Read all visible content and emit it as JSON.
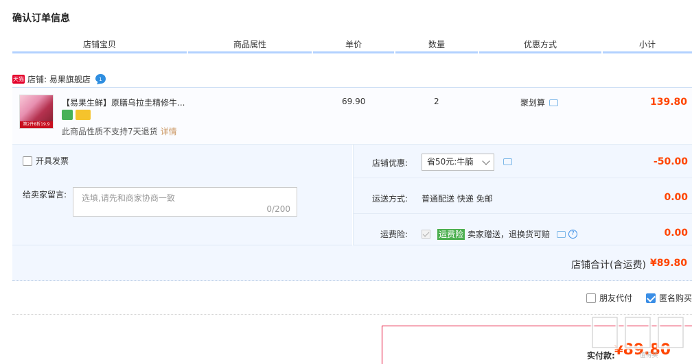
{
  "page_title": "确认订单信息",
  "columns": [
    "店铺宝贝",
    "商品属性",
    "单价",
    "数量",
    "优惠方式",
    "小计"
  ],
  "shop": {
    "badge": "天猫",
    "label": "店铺: 易果旗舰店",
    "wangwang_count": "1"
  },
  "item": {
    "thumb_badge": "第2件8折19.9",
    "title": "【易果生鲜】原膳乌拉圭精修牛...",
    "no_return": "此商品性质不支持7天退货",
    "detail_link": "详情",
    "price": "69.90",
    "quantity": "2",
    "promo": "聚划算",
    "subtotal": "139.80"
  },
  "invoice": {
    "label": "开具发票"
  },
  "note": {
    "label": "给卖家留言:",
    "placeholder": "选填,请先和商家协商一致",
    "counter": "0/200"
  },
  "shop_promo": {
    "label": "店铺优惠:",
    "selected": "省50元:牛腩",
    "amount": "-50.00"
  },
  "shipping": {
    "label": "运送方式:",
    "value": "普通配送 快递 免邮",
    "amount": "0.00"
  },
  "insurance": {
    "label": "运费险:",
    "tag": "运费险",
    "value": "卖家赠送，退换货可赔",
    "help": "?",
    "amount": "0.00"
  },
  "shop_total": {
    "label": "店铺合计(含运费)",
    "amount": "¥89.80"
  },
  "pay_options": {
    "friend_pay": "朋友代付",
    "anonymous": "匿名购买"
  },
  "final": {
    "label": "实付款:",
    "currency": "¥",
    "amount": "89.80"
  },
  "watermark": "值得买",
  "colors": {
    "accent": "#f40",
    "header_line": "#b2d1ff",
    "panel_bg": "#f2f7ff",
    "check_blue": "#3a8ee6"
  }
}
